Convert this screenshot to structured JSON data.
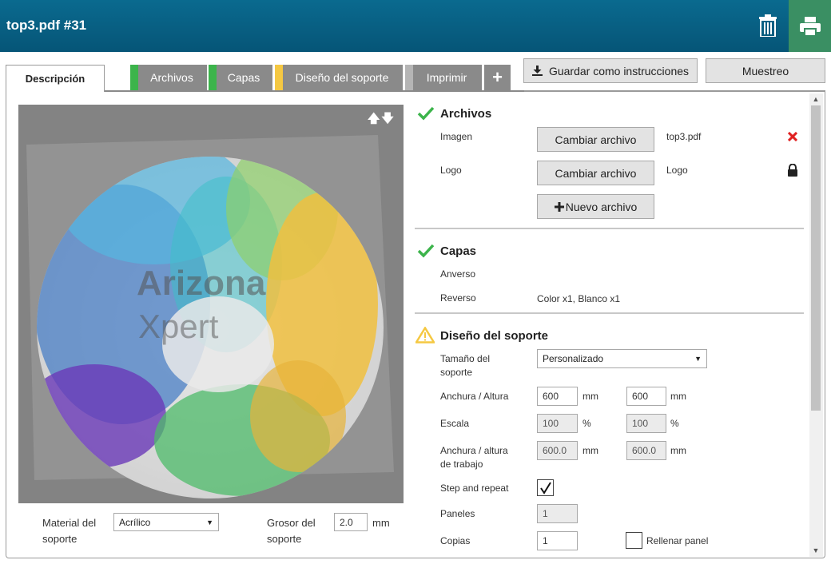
{
  "header": {
    "title": "top3.pdf #31"
  },
  "tabs": [
    {
      "label": "Descripción"
    },
    {
      "label": "Archivos",
      "stripe": "#3cb44b"
    },
    {
      "label": "Capas",
      "stripe": "#3cb44b"
    },
    {
      "label": "Diseño del soporte",
      "stripe": "#f5c842"
    },
    {
      "label": "Imprimir",
      "stripe": "#b5b5b5"
    }
  ],
  "toolbar": {
    "save_label": "Guardar como instrucciones",
    "sample_label": "Muestreo",
    "add_symbol": "+"
  },
  "preview": {
    "watermark_line1": "Arizona",
    "watermark_line2": "Xpert"
  },
  "bottom": {
    "material_label": "Material del soporte",
    "material_value": "Acrílico",
    "thickness_label": "Grosor del soporte",
    "thickness_value": "2.0",
    "thickness_unit": "mm"
  },
  "archivos": {
    "title": "Archivos",
    "status": "ok",
    "image_label": "Imagen",
    "image_button": "Cambiar archivo",
    "image_file": "top3.pdf",
    "logo_label": "Logo",
    "logo_button": "Cambiar archivo",
    "logo_file": "Logo",
    "new_file_button": "Nuevo archivo"
  },
  "capas": {
    "title": "Capas",
    "status": "ok",
    "front_label": "Anverso",
    "back_label": "Reverso",
    "back_value": "Color x1, Blanco x1"
  },
  "diseno": {
    "title": "Diseño del soporte",
    "status": "warning",
    "size_label": "Tamaño del soporte",
    "size_value": "Personalizado",
    "wh_label": "Anchura / Altura",
    "width": "600",
    "height": "600",
    "mm": "mm",
    "scale_label": "Escala",
    "scale_x": "100",
    "scale_y": "100",
    "pct": "%",
    "work_label": "Anchura / altura de trabajo",
    "work_w": "600.0",
    "work_h": "600.0",
    "step_label": "Step and repeat",
    "step_checked": true,
    "panels_label": "Paneles",
    "panels_value": "1",
    "copies_label": "Copias",
    "copies_value": "1",
    "fill_label": "Rellenar panel",
    "fill_checked": false
  },
  "colors": {
    "header": "#065577",
    "print": "#3a8f63",
    "ok": "#3cb44b",
    "warning": "#f5c842",
    "delete": "#e02020"
  }
}
